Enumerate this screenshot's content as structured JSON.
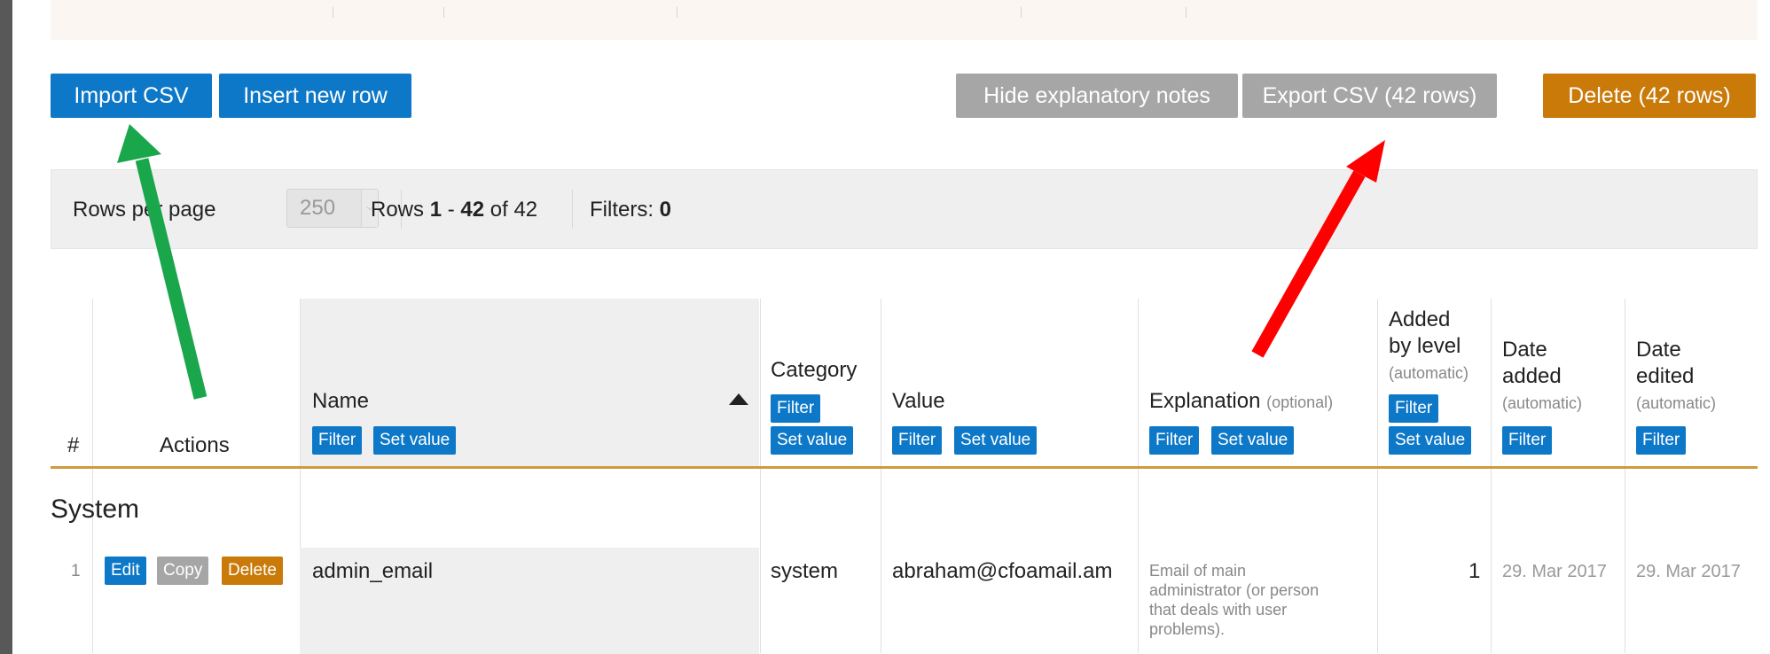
{
  "toolbar_top": {
    "import_csv": "Import CSV",
    "insert_row": "Insert new row",
    "hide_notes": "Hide explanatory notes",
    "export_csv": "Export CSV (42 rows)",
    "delete_rows": "Delete (42 rows)"
  },
  "pagination": {
    "rows_per_page_label": "Rows per page",
    "rows_per_page_value": "250",
    "rows_prefix": "Rows",
    "rows_from": "1",
    "rows_dash": "-",
    "rows_to": "42",
    "rows_of": "of 42",
    "filters_label": "Filters:",
    "filters_count": "0"
  },
  "table": {
    "headers": {
      "index": "#",
      "actions": "Actions",
      "name": "Name",
      "category": "Category",
      "value": "Value",
      "explanation": "Explanation",
      "explanation_note": "(optional)",
      "added_by_level_l1": "Added",
      "added_by_level_l2": "by level",
      "date_added_l1": "Date",
      "date_added_l2": "added",
      "date_edited_l1": "Date",
      "date_edited_l2": "edited",
      "automatic": "(automatic)"
    },
    "filter_label": "Filter",
    "set_value_label": "Set value",
    "group_title": "System",
    "rows": [
      {
        "index": "1",
        "edit": "Edit",
        "copy": "Copy",
        "delete": "Delete",
        "name": "admin_email",
        "category": "system",
        "value": "abraham@cfoamail.am",
        "explanation_l1": "Email of main",
        "explanation_l2": "administrator (or person",
        "explanation_l3": "that deals with user",
        "explanation_l4": "problems).",
        "added_by_level": "1",
        "date_added": "29. Mar 2017",
        "date_edited": "29. Mar 2017"
      }
    ]
  },
  "colors": {
    "primary": "#0e78c8",
    "secondary": "#a6a6a6",
    "danger": "#c97a09",
    "arrow_green": "#1aa64b",
    "arrow_red": "#ff0000"
  }
}
